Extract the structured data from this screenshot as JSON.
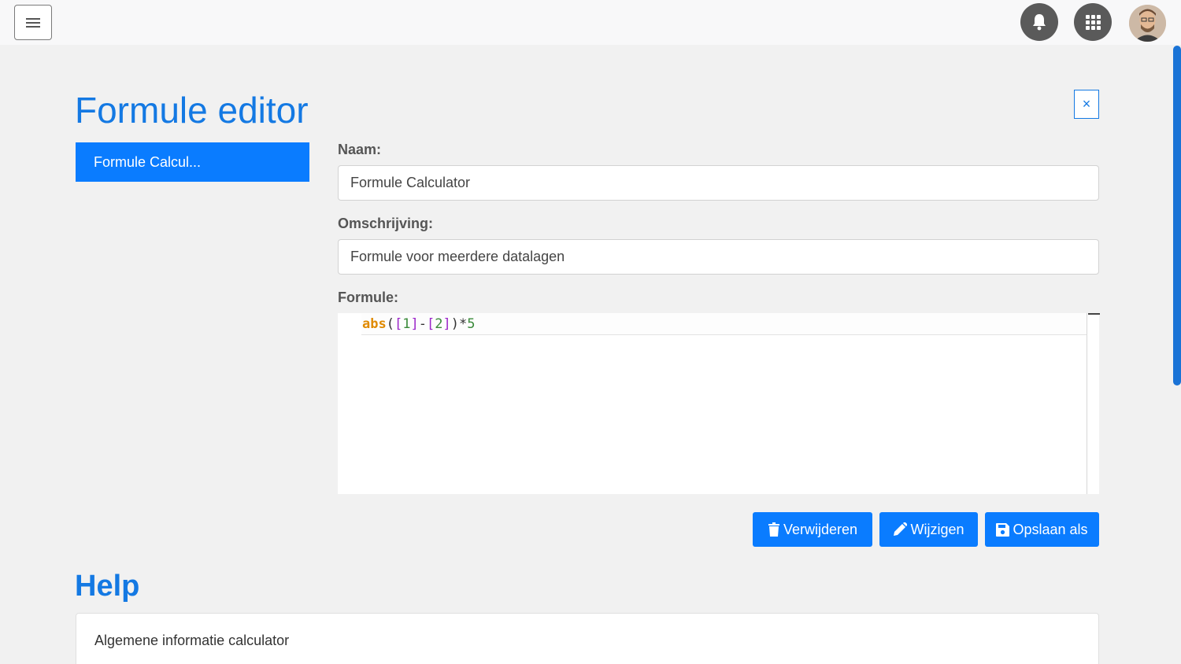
{
  "header": {
    "menu_icon": "hamburger-icon",
    "notifications_icon": "bell-icon",
    "apps_icon": "grid-icon",
    "avatar_icon": "user-avatar"
  },
  "page": {
    "title": "Formule editor",
    "close_label": "×"
  },
  "formula_list": {
    "items": [
      {
        "label": "Formule Calcul...",
        "selected": true
      }
    ]
  },
  "form": {
    "name_label": "Naam:",
    "name_value": "Formule Calculator",
    "description_label": "Omschrijving:",
    "description_value": "Formule voor meerdere datalagen",
    "formula_label": "Formule:",
    "formula_tokens": {
      "fn": "abs",
      "open": "(",
      "b1_open": "[",
      "n1": "1",
      "b1_close": "]",
      "minus": "-",
      "b2_open": "[",
      "n2": "2",
      "b2_close": "]",
      "close": ")",
      "times": "*",
      "n3": "5"
    }
  },
  "actions": {
    "delete_label": "Verwijderen",
    "delete_icon": "trash-icon",
    "edit_label": "Wijzigen",
    "edit_icon": "pencil-icon",
    "save_as_label": "Opslaan als",
    "save_icon": "floppy-icon"
  },
  "help": {
    "title": "Help",
    "card_text": "Algemene informatie calculator"
  },
  "colors": {
    "accent": "#0a7cff",
    "title": "#1479e3",
    "background": "#f1f1f1"
  }
}
